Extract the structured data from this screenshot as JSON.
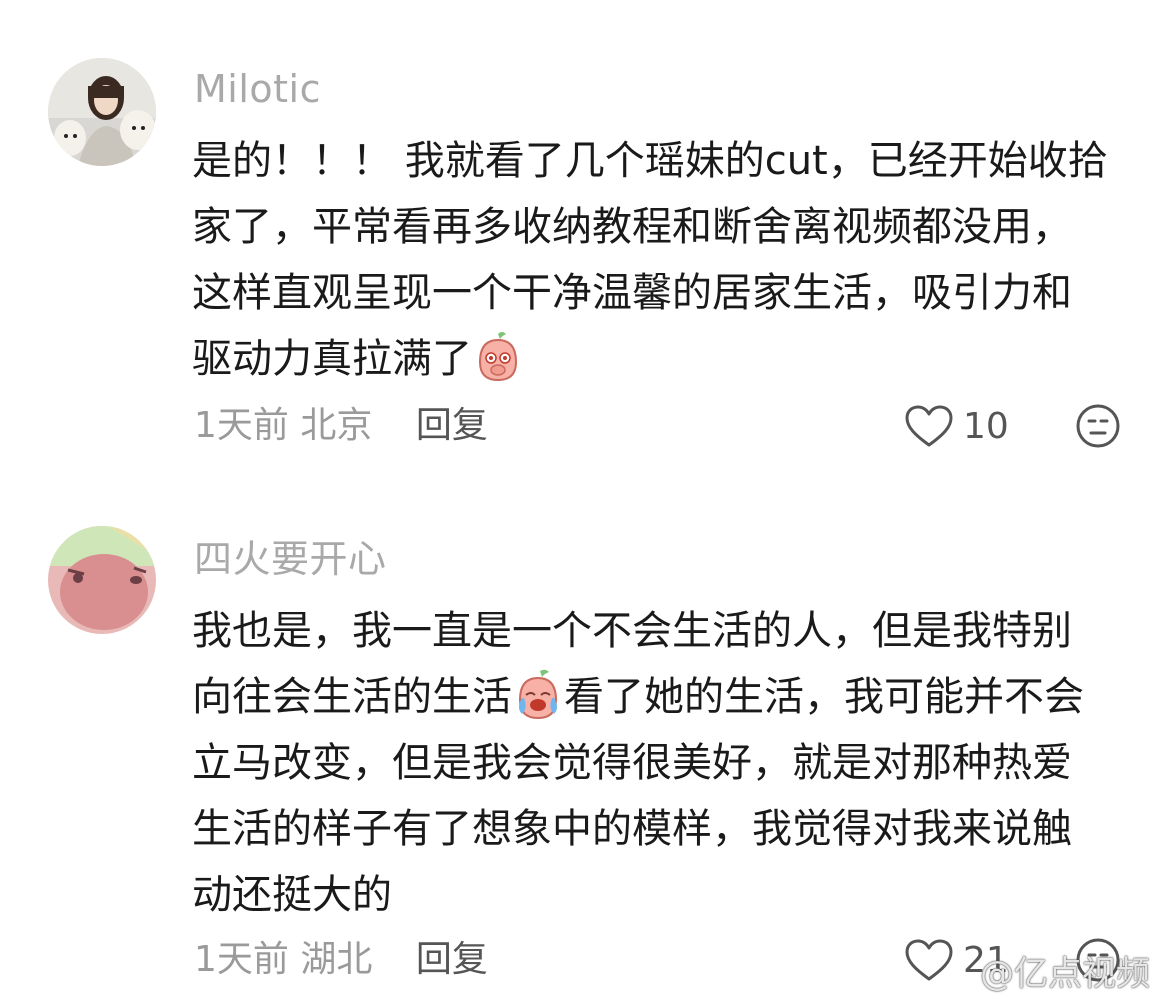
{
  "comments": [
    {
      "username": "Milotic",
      "lines": [
        "是的！！！ 我就看了几个瑶妹的cut，已经开始收拾",
        "家了，平常看再多收纳教程和断舍离视频都没用，",
        "这样直观呈现一个干净温馨的居家生活，吸引力和",
        "驱动力真拉满了"
      ],
      "emoji": "peach-shy-emoji",
      "time": "1天前",
      "location": "北京",
      "reply_label": "回复",
      "likes": "10",
      "avatar": "avatar-photo-with-dogs"
    },
    {
      "username": "四火要开心",
      "lines_parts": {
        "l1": "我也是，我一直是一个不会生活的人，但是我特别",
        "l2a": "向往会生活的生活",
        "l2b": "看了她的生活，我可能并不会",
        "l3": "立马改变，但是我会觉得很美好，就是对那种热爱",
        "l4": "生活的样子有了想象中的模样，我觉得对我来说触",
        "l5": "动还挺大的"
      },
      "emoji": "peach-crying-emoji",
      "time": "1天前",
      "location": "湖北",
      "reply_label": "回复",
      "likes": "21",
      "avatar": "avatar-cartoon-pig"
    }
  ],
  "watermark": "@亿点视频",
  "colors": {
    "username": "#a9a9a9",
    "meta": "#9a9a9a",
    "text": "#1a1a1a",
    "icon": "#555555"
  }
}
